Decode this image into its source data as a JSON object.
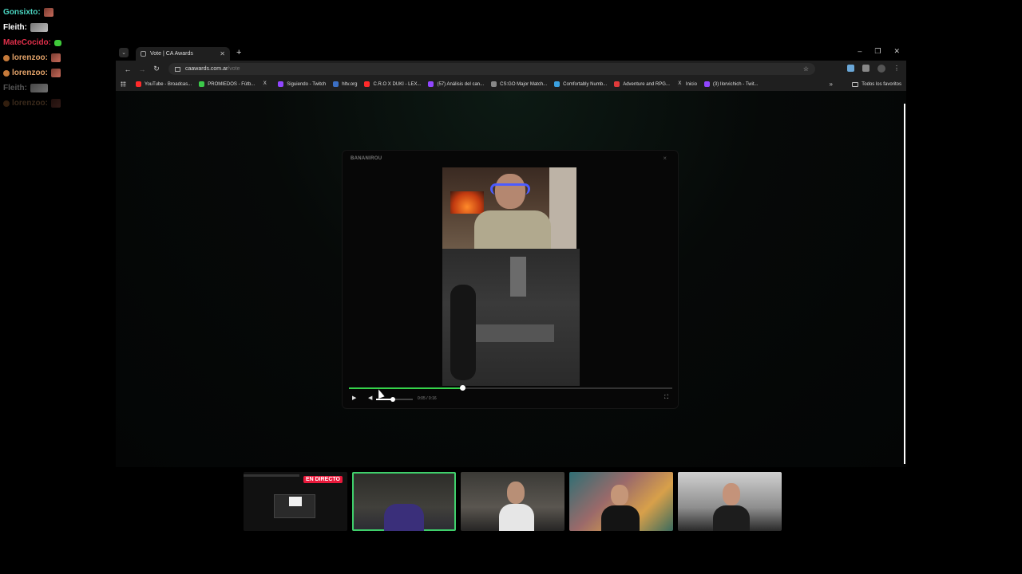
{
  "chat": [
    {
      "user": "Gonsixto:",
      "color": "#4ad5c0",
      "emote": "red"
    },
    {
      "user": "Fleith:",
      "color": "#ffffff",
      "emote": "grey"
    },
    {
      "user": "MateCocido:",
      "color": "#e02f4a",
      "emote": "green"
    },
    {
      "user": "lorenzoo:",
      "color": "#e3a36a",
      "emote": "red"
    },
    {
      "user": "lorenzoo:",
      "color": "#e3a36a",
      "emote": "red"
    },
    {
      "user": "Fleith:",
      "color": "#8a8a8a",
      "emote": "grey"
    },
    {
      "user": "lorenzoo:",
      "color": "#3a2a20",
      "emote": "red"
    }
  ],
  "browser": {
    "tab_title": "Vote | CA Awards",
    "tab_icon": "shield-icon",
    "url_host": "caawards.com.ar",
    "url_path": "/vote",
    "bookmarks": [
      {
        "label": "YouTube - Broadcas...",
        "color": "#ff2a2a"
      },
      {
        "label": "PROMIEDOS - Fútb...",
        "color": "#3cc94a"
      },
      {
        "label": "",
        "color": "#222222",
        "icon": "x-icon"
      },
      {
        "label": "Siguiendo - Twitch",
        "color": "#9146ff"
      },
      {
        "label": "hltv.org",
        "color": "#3b6fc4"
      },
      {
        "label": "C.R.O X DUKI - LEX...",
        "color": "#ff2a2a"
      },
      {
        "label": "(57) Análisis del can...",
        "color": "#9146ff"
      },
      {
        "label": "CS:GO Major Match...",
        "color": "#888888"
      },
      {
        "label": "Comfortably Numb...",
        "color": "#3aa0e0"
      },
      {
        "label": "Adventure and RPG...",
        "color": "#e03a3a"
      },
      {
        "label": "Inicio",
        "color": "#222222"
      },
      {
        "label": "(3) Ilorvichich - Twit...",
        "color": "#9146ff"
      }
    ],
    "all_bookmarks": "Todos los favoritos"
  },
  "modal": {
    "title": "BANANIROU",
    "close": "×",
    "time": "0:05 / 0:16",
    "progress": 0.35,
    "volume": 0.45
  },
  "cams": {
    "live_label": "EN DIRECTO"
  },
  "colors": {
    "accent": "#35d24a",
    "live": "#e9193b"
  }
}
